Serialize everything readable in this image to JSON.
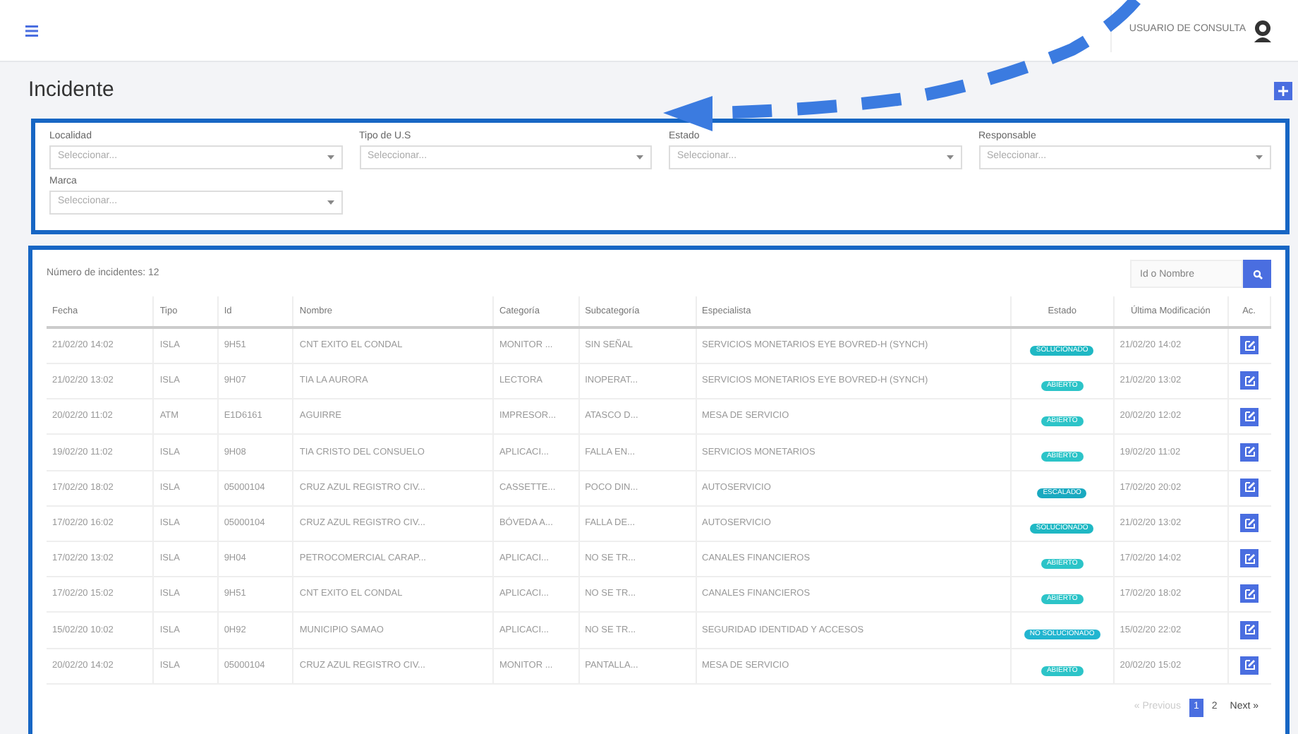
{
  "topbar": {
    "user": "USUARIO DE CONSULTA"
  },
  "page": {
    "title": "Incidente"
  },
  "filters": [
    {
      "label": "Localidad",
      "placeholder": "Seleccionar..."
    },
    {
      "label": "Tipo de U.S",
      "placeholder": "Seleccionar..."
    },
    {
      "label": "Estado",
      "placeholder": "Seleccionar..."
    },
    {
      "label": "Responsable",
      "placeholder": "Seleccionar..."
    },
    {
      "label": "Marca",
      "placeholder": "Seleccionar..."
    }
  ],
  "table": {
    "count": "Número de incidentes: 12",
    "search_placeholder": "Id o Nombre",
    "columns": [
      "Fecha",
      "Tipo",
      "Id",
      "Nombre",
      "Categoría",
      "Subcategoría",
      "Especialista",
      "Estado",
      "Última Modificación",
      "Ac."
    ],
    "rows": [
      {
        "cells": [
          "21/02/20 14:02",
          "ISLA",
          "9H51",
          "CNT EXITO EL CONDAL",
          "MONITOR ...",
          "SIN SEÑAL",
          "SERVICIOS MONETARIOS EYE BOVRED-H (SYNCH)"
        ],
        "status": "SOLUCIONADO",
        "modified": "21/02/20 14:02"
      },
      {
        "cells": [
          "21/02/20 13:02",
          "ISLA",
          "9H07",
          "TIA LA AURORA",
          "LECTORA",
          "INOPERAT...",
          "SERVICIOS MONETARIOS EYE BOVRED-H (SYNCH)"
        ],
        "status": "ABIERTO",
        "modified": "21/02/20 13:02"
      },
      {
        "cells": [
          "20/02/20 11:02",
          "ATM",
          "E1D6161",
          "AGUIRRE",
          "IMPRESOR...",
          "ATASCO D...",
          "MESA DE SERVICIO"
        ],
        "status": "ABIERTO",
        "modified": "20/02/20 12:02"
      },
      {
        "cells": [
          "19/02/20 11:02",
          "ISLA",
          "9H08",
          "TIA CRISTO DEL CONSUELO",
          "APLICACI...",
          "FALLA EN...",
          "SERVICIOS MONETARIOS"
        ],
        "status": "ABIERTO",
        "modified": "19/02/20 11:02"
      },
      {
        "cells": [
          "17/02/20 18:02",
          "ISLA",
          "05000104",
          "CRUZ AZUL REGISTRO CIV...",
          "CASSETTE...",
          "POCO DIN...",
          "AUTOSERVICIO"
        ],
        "status": "ESCALADO",
        "modified": "17/02/20 20:02"
      },
      {
        "cells": [
          "17/02/20 16:02",
          "ISLA",
          "05000104",
          "CRUZ AZUL REGISTRO CIV...",
          "BÓVEDA A...",
          "FALLA DE...",
          "AUTOSERVICIO"
        ],
        "status": "SOLUCIONADO",
        "modified": "21/02/20 13:02"
      },
      {
        "cells": [
          "17/02/20 13:02",
          "ISLA",
          "9H04",
          "PETROCOMERCIAL CARAP...",
          "APLICACI...",
          "NO SE TR...",
          "CANALES FINANCIEROS"
        ],
        "status": "ABIERTO",
        "modified": "17/02/20 14:02"
      },
      {
        "cells": [
          "17/02/20 15:02",
          "ISLA",
          "9H51",
          "CNT EXITO EL CONDAL",
          "APLICACI...",
          "NO SE TR...",
          "CANALES FINANCIEROS"
        ],
        "status": "ABIERTO",
        "modified": "17/02/20 18:02"
      },
      {
        "cells": [
          "15/02/20 10:02",
          "ISLA",
          "0H92",
          "MUNICIPIO SAMAO",
          "APLICACI...",
          "NO SE TR...",
          "SEGURIDAD IDENTIDAD Y ACCESOS"
        ],
        "status": "NO SOLUCIONADO",
        "modified": "15/02/20 22:02"
      },
      {
        "cells": [
          "20/02/20 14:02",
          "ISLA",
          "05000104",
          "CRUZ AZUL REGISTRO CIV...",
          "MONITOR ...",
          "PANTALLA...",
          "MESA DE SERVICIO"
        ],
        "status": "ABIERTO",
        "modified": "20/02/20 15:02"
      }
    ]
  },
  "pagination": [
    {
      "label": "« Previous",
      "kind": "nav",
      "disabled": true
    },
    {
      "label": "1",
      "kind": "page",
      "selected": true
    },
    {
      "label": "2",
      "kind": "page",
      "selected": false
    },
    {
      "label": "Next »",
      "kind": "nav",
      "disabled": false
    }
  ]
}
